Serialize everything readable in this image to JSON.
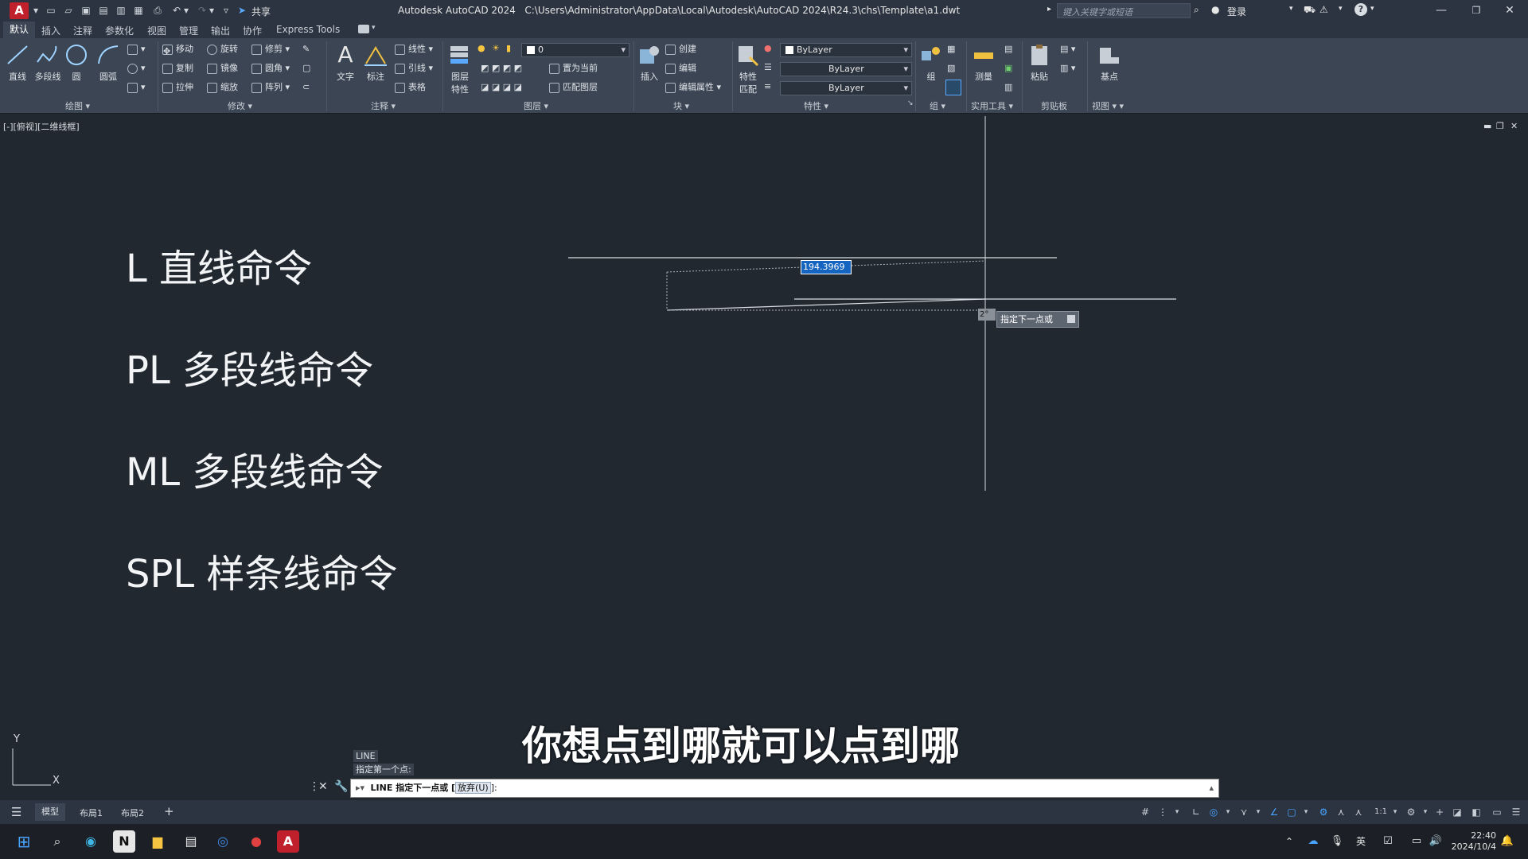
{
  "titlebar": {
    "logo": "A",
    "share": "共享",
    "app_title": "Autodesk AutoCAD 2024",
    "file_path": "C:\\Users\\Administrator\\AppData\\Local\\Autodesk\\AutoCAD 2024\\R24.3\\chs\\Template\\a1.dwt",
    "search_placeholder": "键入关键字或短语",
    "login": "登录"
  },
  "tabs": [
    "默认",
    "插入",
    "注释",
    "参数化",
    "视图",
    "管理",
    "输出",
    "协作",
    "Express Tools"
  ],
  "ribbon": {
    "draw": {
      "title": "绘图",
      "line": "直线",
      "polyline": "多段线",
      "circle": "圆",
      "arc": "圆弧"
    },
    "modify": {
      "title": "修改",
      "move": "移动",
      "rotate": "旋转",
      "trim": "修剪",
      "copy": "复制",
      "mirror": "镜像",
      "fillet": "圆角",
      "stretch": "拉伸",
      "scale": "缩放",
      "array": "阵列"
    },
    "annotation": {
      "title": "注释",
      "text": "文字",
      "dimension": "标注",
      "linear": "线性",
      "leader": "引线",
      "table": "表格"
    },
    "layers": {
      "title": "图层",
      "layer_props_1": "图层",
      "layer_props_2": "特性",
      "current_layer": "0",
      "set_current": "置为当前",
      "match_layer": "匹配图层"
    },
    "block": {
      "title": "块",
      "insert": "插入",
      "create": "创建",
      "edit": "编辑",
      "edit_attr": "编辑属性"
    },
    "properties": {
      "title": "特性",
      "match_1": "特性",
      "match_2": "匹配",
      "color": "ByLayer",
      "linetype": "ByLayer",
      "lineweight": "ByLayer"
    },
    "groups": {
      "title": "组",
      "group": "组"
    },
    "utilities": {
      "title": "实用工具",
      "measure": "测量"
    },
    "clipboard": {
      "title": "剪贴板",
      "paste": "粘贴"
    },
    "view": {
      "title": "视图",
      "base": "基点"
    }
  },
  "viewport": {
    "label": "[-][俯视][二维线框]",
    "lines": [
      "L 直线命令",
      "PL 多段线命令",
      "ML 多段线命令",
      "SPL 样条线命令"
    ],
    "dynamic_input": "194.3969",
    "angle": "2°",
    "tooltip": "指定下一点或",
    "ucs_y": "Y",
    "ucs_x": "X"
  },
  "subtitle": "你想点到哪就可以点到哪",
  "command": {
    "history_1": "LINE",
    "history_2": "指定第一个点:",
    "current_prefix": "LINE 指定下一点或 [",
    "current_option": "放弃(U)",
    "current_suffix": "]:"
  },
  "layout_tabs": [
    "模型",
    "布局1",
    "布局2"
  ],
  "status": {
    "scale": "1:1"
  },
  "tray": {
    "lang": "英",
    "time": "22:40",
    "date": "2024/10/4"
  }
}
